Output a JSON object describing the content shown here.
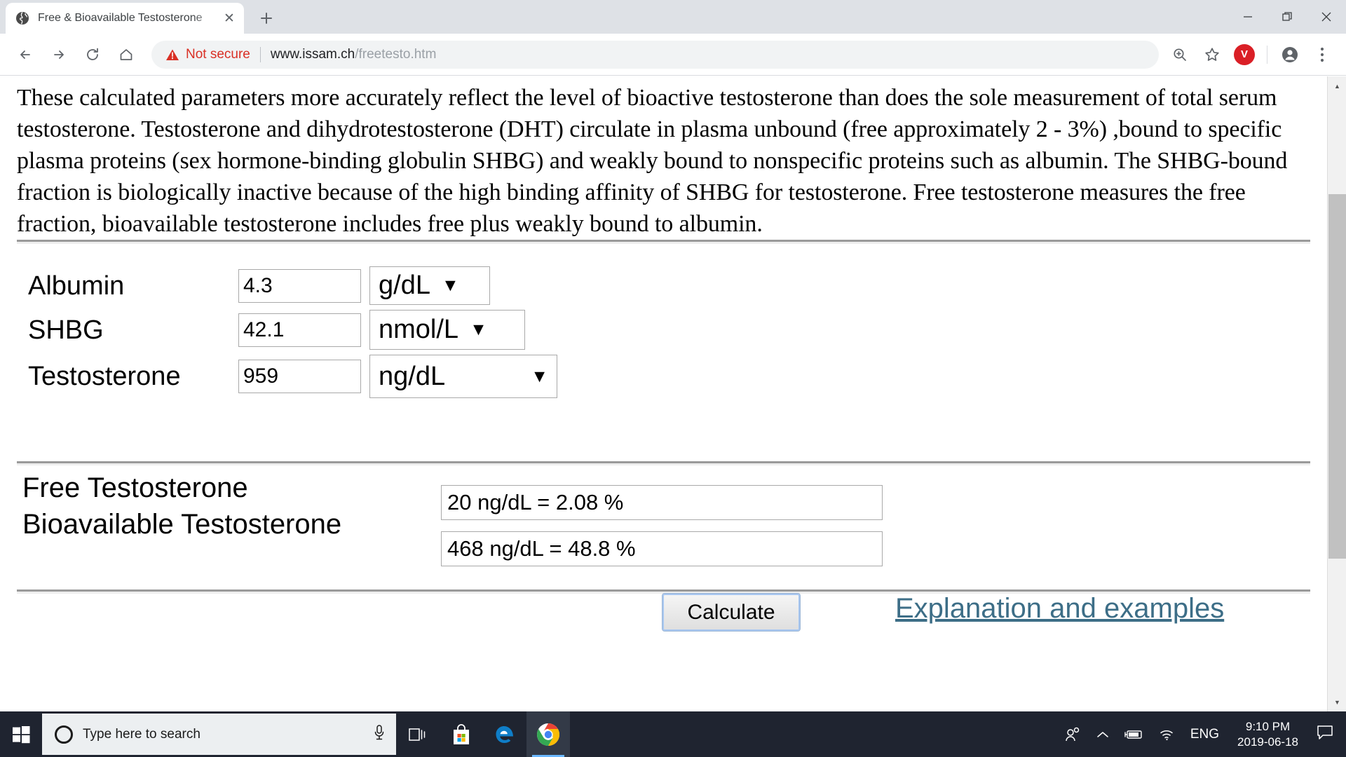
{
  "browser": {
    "tab": {
      "title": "Free & Bioavailable Testosterone",
      "favicon_name": "globe-icon",
      "close_label": "✕"
    },
    "newtab_label": "+",
    "window_controls": {
      "minimize": "—",
      "maximize": "❐",
      "close": "✕"
    },
    "toolbar": {
      "back_label": "←",
      "forward_label": "→",
      "reload_label": "⟳",
      "home_label": "⌂",
      "security_label": "Not secure",
      "security_color": "#d93025",
      "url_host": "www.issam.ch",
      "url_path": "/freetesto.htm",
      "zoom_icon": "search-zoom-icon",
      "bookmark_icon": "star-icon",
      "extension_label": "V",
      "extension_color": "#da1f26",
      "profile_icon": "profile-avatar-icon",
      "menu_icon": "three-dot-menu-icon"
    }
  },
  "page": {
    "intro": "These calculated parameters more accurately reflect the level of bioactive testosterone than does the sole measurement of total serum testosterone. Testosterone and dihydrotestosterone (DHT) circulate in plasma unbound (free approximately 2 - 3%) ,bound to specific plasma proteins (sex hormone-binding globulin SHBG) and weakly bound to nonspecific proteins such as albumin. The SHBG-bound fraction is biologically inactive because of the high binding affinity of SHBG for testosterone. Free testosterone measures the free fraction, bioavailable testosterone includes free plus weakly bound to albumin.",
    "form": {
      "rows": [
        {
          "label": "Albumin",
          "value": "4.3",
          "unit": "g/dL"
        },
        {
          "label": "SHBG",
          "value": "42.1",
          "unit": "nmol/L"
        },
        {
          "label": "Testosterone",
          "value": "959",
          "unit": "ng/dL"
        }
      ],
      "dropdown_arrow": "▼",
      "calculate_label": "Calculate",
      "link_label": "Explanation and examples",
      "link_color": "#3d6e87"
    },
    "results": {
      "rows": [
        {
          "label": "Free Testosterone",
          "value": "20 ng/dL  =  2.08 %"
        },
        {
          "label": "Bioavailable Testosterone",
          "value": "468 ng/dL  =  48.8 %"
        }
      ]
    },
    "scrollbar": {
      "up_arrow": "▲",
      "down_arrow": "▼"
    }
  },
  "taskbar": {
    "start_icon": "windows-start-icon",
    "search_placeholder": "Type here to search",
    "mic_icon": "microphone-icon",
    "taskview_icon": "task-view-icon",
    "store_icon": "microsoft-store-icon",
    "edge_icon": "edge-browser-icon",
    "chrome_icon": "chrome-browser-icon",
    "tray": {
      "people_icon": "people-icon",
      "chevron_icon": "chevron-up-icon",
      "battery_icon": "battery-charging-icon",
      "network_icon": "wifi-icon",
      "language": "ENG",
      "time": "9:10 PM",
      "date": "2019-06-18",
      "notification_icon": "notification-bubble-icon"
    }
  }
}
